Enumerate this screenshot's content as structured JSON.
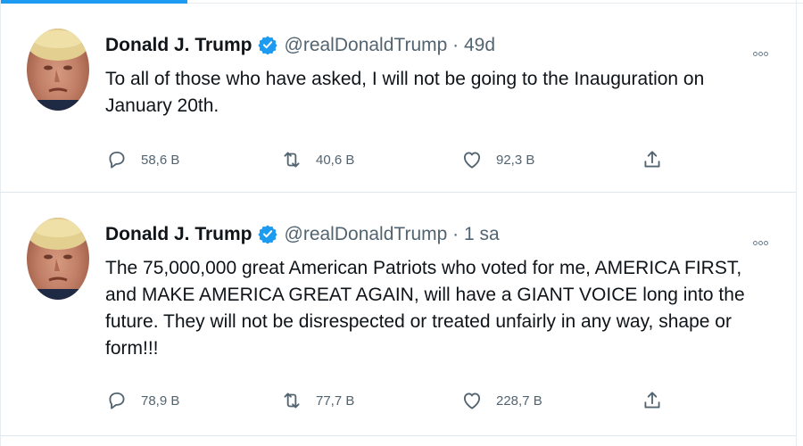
{
  "tweets": [
    {
      "author_name": "Donald J. Trump",
      "handle": "@realDonaldTrump",
      "separator": "·",
      "time": "49d",
      "text": "To all of those who have asked, I will not be going to the Inauguration on January 20th.",
      "replies": "58,6 B",
      "retweets": "40,6 B",
      "likes": "92,3 B"
    },
    {
      "author_name": "Donald J. Trump",
      "handle": "@realDonaldTrump",
      "separator": "·",
      "time": "1 sa",
      "text": "The 75,000,000 great American Patriots who voted for me, AMERICA FIRST, and MAKE AMERICA GREAT AGAIN, will have a GIANT VOICE long into the future. They will not be disrespected or treated unfairly in any way, shape or form!!!",
      "replies": "78,9 B",
      "retweets": "77,7 B",
      "likes": "228,7 B"
    }
  ],
  "icons": {
    "reply": "reply-icon",
    "retweet": "retweet-icon",
    "like": "heart-icon",
    "share": "share-icon",
    "verified": "verified-badge-icon",
    "more": "more-options-icon"
  },
  "colors": {
    "accent": "#1d9bf0",
    "text": "#0f1419",
    "muted": "#536471",
    "divider": "#e1e8ed"
  }
}
